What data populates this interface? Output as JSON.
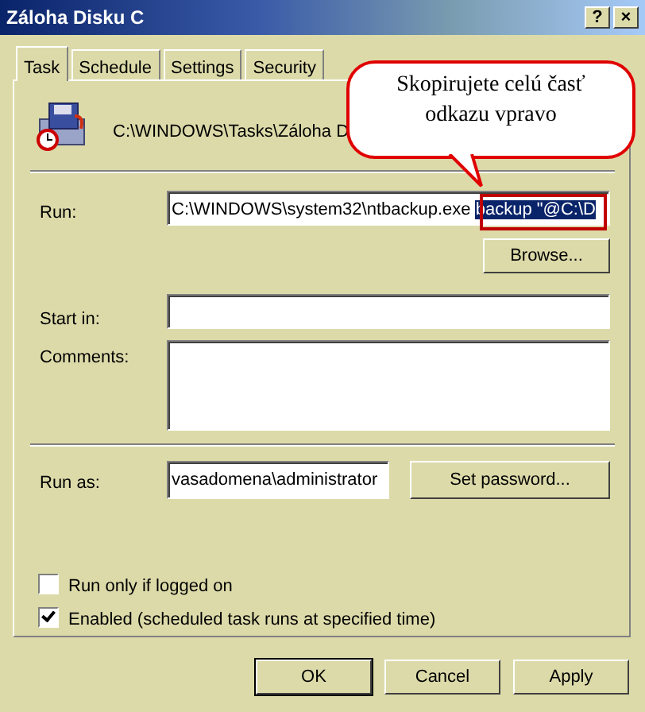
{
  "window": {
    "title": "Záloha Disku C",
    "help_button": "?",
    "close_button": "×"
  },
  "tabs": [
    {
      "label": "Task",
      "selected": true
    },
    {
      "label": "Schedule",
      "selected": false
    },
    {
      "label": "Settings",
      "selected": false
    },
    {
      "label": "Security",
      "selected": false
    }
  ],
  "task_path": "C:\\WINDOWS\\Tasks\\Záloha D",
  "run": {
    "label": "Run:",
    "value": "C:\\WINDOWS\\system32\\ntbackup.exe ",
    "selected_text": "backup \"@C:\\D"
  },
  "browse_button": {
    "label": "Browse..."
  },
  "start_in": {
    "label": "Start in:"
  },
  "comments": {
    "label": "Comments:"
  },
  "run_as": {
    "label": "Run as:",
    "value": "vasadomena\\administrator"
  },
  "set_password_button": {
    "label": "Set password..."
  },
  "checkboxes": [
    {
      "label": "Run only if logged on",
      "checked": false
    },
    {
      "label": "Enabled (scheduled task runs at specified time)",
      "checked": true
    }
  ],
  "buttons": [
    {
      "label": "OK",
      "default": true
    },
    {
      "label": "Cancel",
      "default": false
    },
    {
      "label": "Apply",
      "default": false
    }
  ],
  "callout": {
    "text": "Skopirujete celú časť odkazu vpravo"
  }
}
